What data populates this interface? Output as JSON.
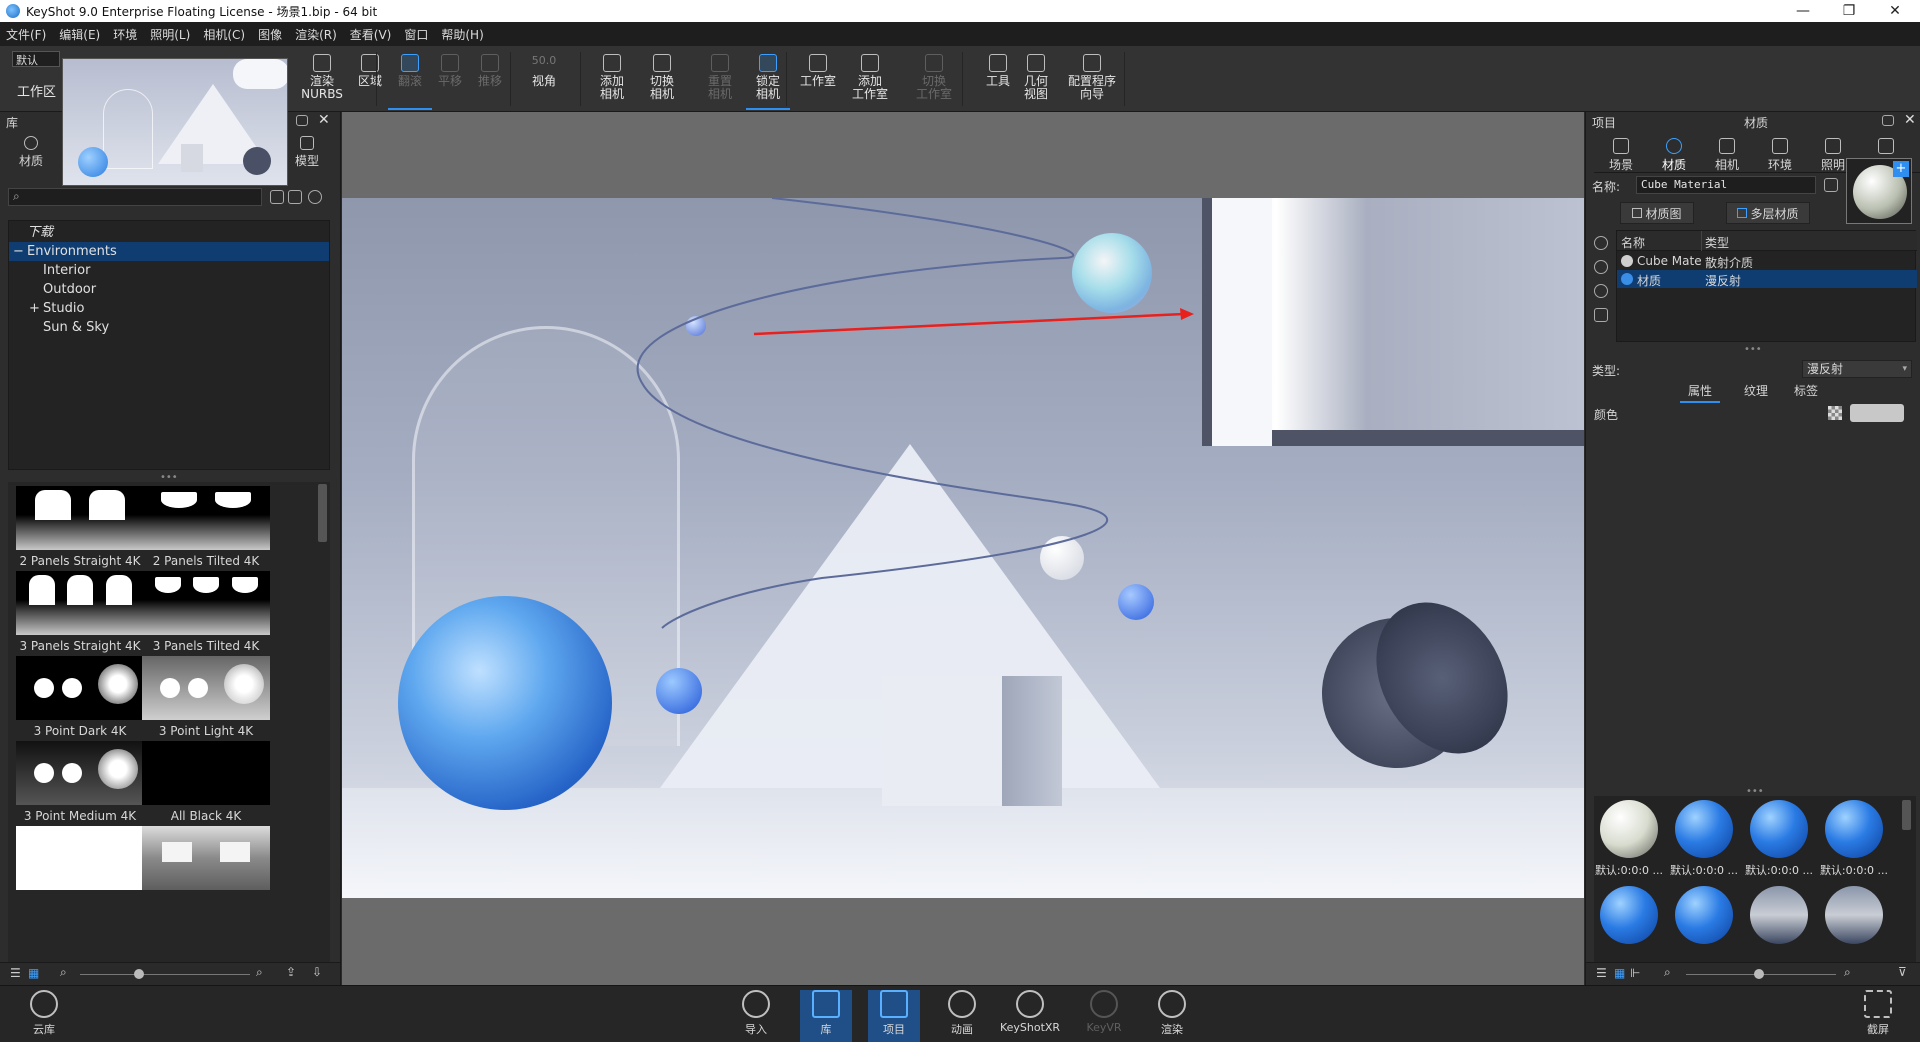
{
  "window": {
    "title": "KeyShot 9.0 Enterprise Floating License  - 场景1.bip  - 64 bit",
    "minimize": "—",
    "maximize": "❐",
    "close": "✕"
  },
  "menu": [
    "文件(F)",
    "编辑(E)",
    "环境",
    "照明(L)",
    "相机(C)",
    "图像",
    "渲染(R)",
    "查看(V)",
    "窗口",
    "帮助(H)"
  ],
  "ribbon": {
    "workspace_select": "默认",
    "workspace_label": "工作区",
    "buttons": [
      {
        "label": "渲染\nNURBS",
        "icon": "nurbs-icon",
        "enabled": true
      },
      {
        "label": "区域",
        "icon": "region-icon",
        "enabled": true
      },
      {
        "label": "翻滚",
        "icon": "tumble-icon",
        "enabled": false,
        "active": true
      },
      {
        "label": "平移",
        "icon": "pan-icon",
        "enabled": false
      },
      {
        "label": "推移",
        "icon": "dolly-icon",
        "enabled": false
      },
      {
        "label": "视角",
        "icon": "fov-icon",
        "enabled": true,
        "value": "50.0"
      },
      {
        "label": "添加\n相机",
        "icon": "add-camera-icon",
        "enabled": true
      },
      {
        "label": "切换\n相机",
        "icon": "switch-camera-icon",
        "enabled": true
      },
      {
        "label": "重置\n相机",
        "icon": "reset-camera-icon",
        "enabled": false
      },
      {
        "label": "锁定\n相机",
        "icon": "lock-camera-icon",
        "enabled": true,
        "active": true
      },
      {
        "label": "工作室",
        "icon": "studio-icon",
        "enabled": true
      },
      {
        "label": "添加\n工作室",
        "icon": "add-studio-icon",
        "enabled": true
      },
      {
        "label": "切换\n工作室",
        "icon": "switch-studio-icon",
        "enabled": false
      },
      {
        "label": "工具",
        "icon": "tools-icon",
        "enabled": true
      },
      {
        "label": "几何\n视图",
        "icon": "geometry-view-icon",
        "enabled": true
      },
      {
        "label": "配置程序\n向导",
        "icon": "configurator-icon",
        "enabled": true
      }
    ]
  },
  "library": {
    "title": "库",
    "tabs": [
      {
        "label": "材质",
        "icon": "material-icon"
      },
      {
        "label": "模型",
        "icon": "model-icon"
      }
    ],
    "search_placeholder": "",
    "tree": [
      {
        "label": "下载",
        "level": 0,
        "italic": true
      },
      {
        "label": "Environments",
        "level": 0,
        "selected": true,
        "expanded": true
      },
      {
        "label": "Interior",
        "level": 1
      },
      {
        "label": "Outdoor",
        "level": 1
      },
      {
        "label": "Studio",
        "level": 1,
        "collapsed": true
      },
      {
        "label": "Sun & Sky",
        "level": 1
      }
    ],
    "items": [
      {
        "label": "2 Panels Straight 4K",
        "kind": "panels2s"
      },
      {
        "label": "2 Panels Tilted 4K",
        "kind": "panels2t"
      },
      {
        "label": "3 Panels Straight 4K",
        "kind": "panels3s"
      },
      {
        "label": "3 Panels Tilted 4K",
        "kind": "panels3t"
      },
      {
        "label": "3 Point Dark 4K",
        "kind": "pointdark"
      },
      {
        "label": "3 Point Light 4K",
        "kind": "pointlight"
      },
      {
        "label": "3 Point Medium 4K",
        "kind": "pointmed"
      },
      {
        "label": "All Black 4K",
        "kind": "black"
      },
      {
        "label": "",
        "kind": "white"
      },
      {
        "label": "",
        "kind": "room"
      }
    ]
  },
  "project": {
    "title": "项目",
    "section": "材质",
    "tabs": [
      {
        "label": "场景",
        "icon": "scene-icon"
      },
      {
        "label": "材质",
        "icon": "material-icon",
        "active": true
      },
      {
        "label": "相机",
        "icon": "camera-icon"
      },
      {
        "label": "环境",
        "icon": "environment-icon"
      },
      {
        "label": "照明",
        "icon": "lighting-icon"
      },
      {
        "label": "图像",
        "icon": "image-icon"
      }
    ],
    "name_label": "名称:",
    "name_value": "Cube Material",
    "material_graph_button": "材质图",
    "multi_layer_button": "多层材质",
    "table_headers": [
      "名称",
      "类型"
    ],
    "table_rows": [
      {
        "name": "Cube Materi:",
        "type": "散射介质",
        "selected": false,
        "swatch": "#cfcfcf"
      },
      {
        "name": "材质",
        "type": "漫反射",
        "selected": true,
        "swatch": "#3a8ee6"
      }
    ],
    "type_label": "类型:",
    "type_value": "漫反射",
    "prop_tabs": [
      "属性",
      "纹理",
      "标签"
    ],
    "color_label": "颜色",
    "color_value": "#c8c8c8",
    "balls": [
      {
        "label": "默认:0:0:0 ...",
        "kind": "white"
      },
      {
        "label": "默认:0:0:0 ...",
        "kind": "blue"
      },
      {
        "label": "默认:0:0:0 ...",
        "kind": "blue"
      },
      {
        "label": "默认:0:0:0 ...",
        "kind": "blue"
      },
      {
        "label": "",
        "kind": "blue"
      },
      {
        "label": "",
        "kind": "blue"
      },
      {
        "label": "",
        "kind": "steel"
      },
      {
        "label": "",
        "kind": "steel"
      }
    ]
  },
  "bottom": {
    "cloud": "云库",
    "buttons": [
      {
        "label": "导入",
        "icon": "import-icon"
      },
      {
        "label": "库",
        "icon": "library-icon",
        "active": true
      },
      {
        "label": "项目",
        "icon": "project-icon",
        "active": true
      },
      {
        "label": "动画",
        "icon": "animation-icon"
      },
      {
        "label": "KeyShotXR",
        "icon": "keyshotxr-icon"
      },
      {
        "label": "KeyVR",
        "icon": "keyvr-icon",
        "disabled": true
      },
      {
        "label": "渲染",
        "icon": "render-icon"
      }
    ],
    "screenshot": "截屏"
  },
  "colors": {
    "accent": "#2f8ff0",
    "selected_row": "#0f3d72",
    "arrow": "#e8201e"
  }
}
